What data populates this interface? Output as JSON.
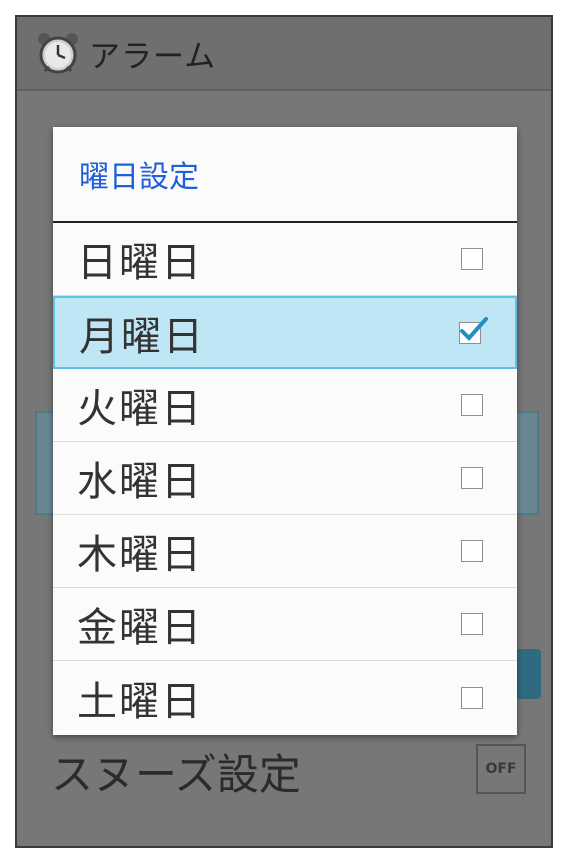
{
  "app": {
    "title": "アラーム"
  },
  "background": {
    "snooze_label": "スヌーズ設定",
    "snooze_toggle": "OFF"
  },
  "dialog": {
    "title": "曜日設定",
    "days": [
      {
        "label": "日曜日",
        "checked": false
      },
      {
        "label": "月曜日",
        "checked": true
      },
      {
        "label": "火曜日",
        "checked": false
      },
      {
        "label": "水曜日",
        "checked": false
      },
      {
        "label": "木曜日",
        "checked": false
      },
      {
        "label": "金曜日",
        "checked": false
      },
      {
        "label": "土曜日",
        "checked": false
      }
    ]
  },
  "colors": {
    "accent_title": "#1f5fd8",
    "selected_row": "#bfe6f4",
    "check": "#1f8fc4"
  }
}
